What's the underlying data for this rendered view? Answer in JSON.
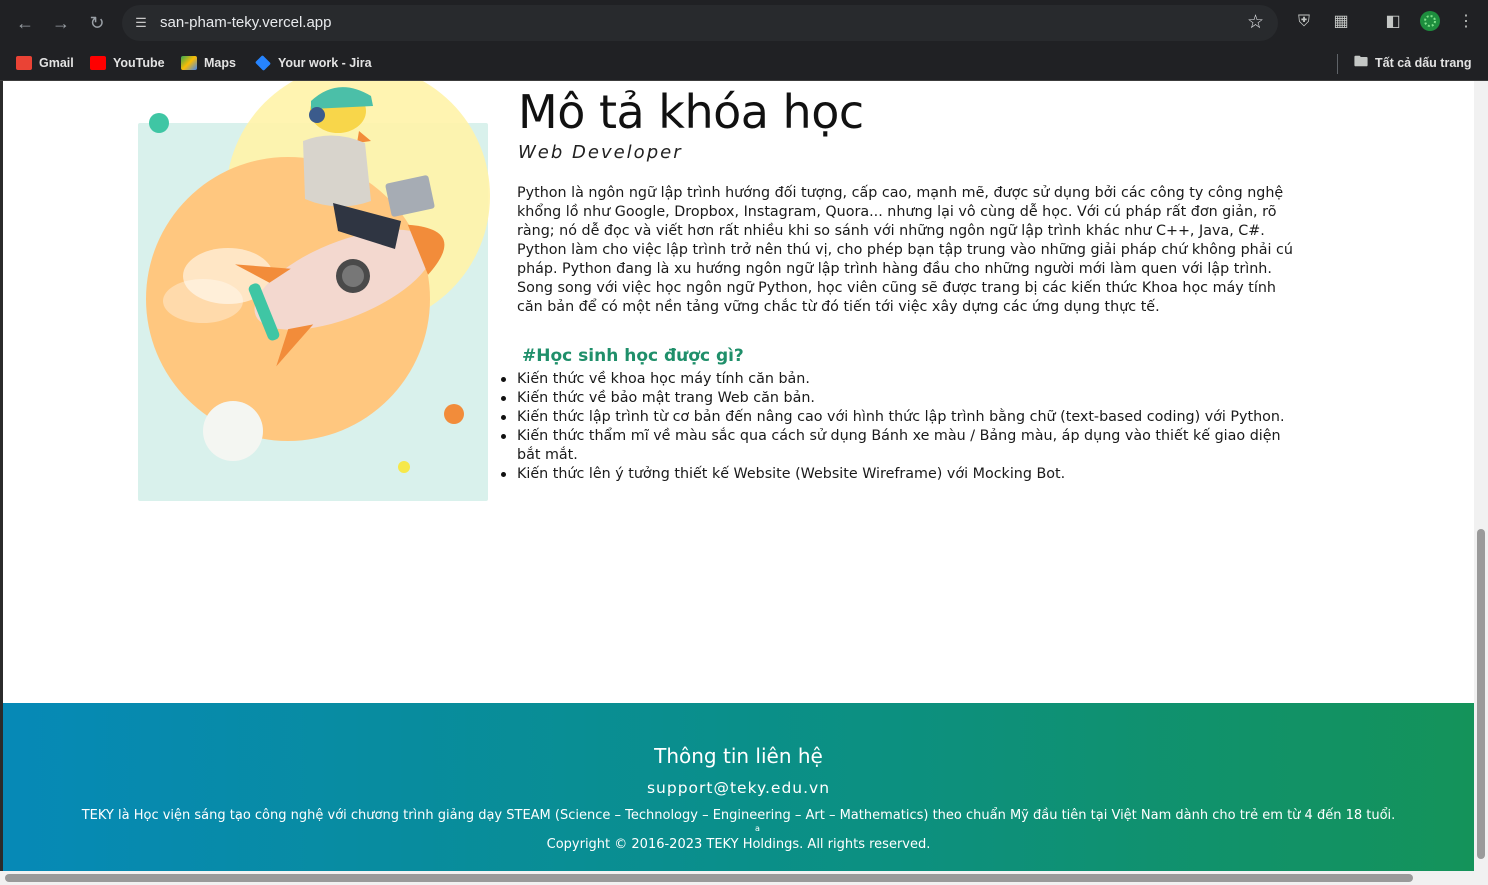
{
  "browser": {
    "url": "san-pham-teky.vercel.app",
    "bookmarks": [
      {
        "label": "Gmail",
        "icon": "gmail-icon",
        "color": "#ea4335"
      },
      {
        "label": "YouTube",
        "icon": "youtube-icon",
        "color": "#ff0000"
      },
      {
        "label": "Maps",
        "icon": "maps-icon",
        "color": "#34a853"
      },
      {
        "label": "Your work - Jira",
        "icon": "jira-icon",
        "color": "#2684ff"
      }
    ],
    "all_bookmarks_label": "Tất cả dấu trang"
  },
  "course": {
    "title": "Mô tả khóa học",
    "subtitle": "Web Developer",
    "description": "Python là ngôn ngữ lập trình hướng đối tượng, cấp cao, mạnh mẽ, được sử dụng bởi các công ty công nghệ khổng lồ như Google, Dropbox, Instagram, Quora... nhưng lại vô cùng dễ học. Với cú pháp rất đơn giản, rõ ràng; nó dễ đọc và viết hơn rất nhiều khi so sánh với những ngôn ngữ lập trình khác như C++, Java, C#. Python làm cho việc lập trình trở nên thú vị, cho phép bạn tập trung vào những giải pháp chứ không phải cú pháp. Python đang là xu hướng ngôn ngữ lập trình hàng đầu cho những người mới làm quen với lập trình. Song song với việc học ngôn ngữ Python, học viên cũng sẽ được trang bị các kiến thức Khoa học máy tính căn bản để có một nền tảng vững chắc từ đó tiến tới việc xây dựng các ứng dụng thực tế.",
    "learn_title": "#Học sinh học được gì?",
    "learn_items": [
      "Kiến thức về khoa học máy tính căn bản.",
      "Kiến thức về bảo mật trang Web căn bản.",
      "Kiến thức lập trình từ cơ bản đến nâng cao với hình thức lập trình bằng chữ (text-based coding) với Python.",
      "Kiến thức thẩm mĩ về màu sắc qua cách sử dụng Bánh xe màu / Bảng màu, áp dụng vào thiết kế giao diện bắt mắt.",
      "Kiến thức lên ý tưởng thiết kế Website (Website Wireframe) với Mocking Bot."
    ]
  },
  "footer": {
    "title": "Thông tin liên hệ",
    "email": "support@teky.edu.vn",
    "about": "TEKY là Học viện sáng tạo công nghệ với chương trình giảng dạy STEAM (Science – Technology – Engineering – Art – Mathematics) theo chuẩn Mỹ đầu tiên tại Việt Nam dành cho trẻ em từ 4 đến 18 tuổi.",
    "mark": "a",
    "copyright": "Copyright © 2016-2023 TEKY Holdings. All rights reserved."
  },
  "colors": {
    "accent_green": "#1f8f6a",
    "footer_gradient_start": "#0689b7",
    "footer_gradient_end": "#14935a"
  }
}
